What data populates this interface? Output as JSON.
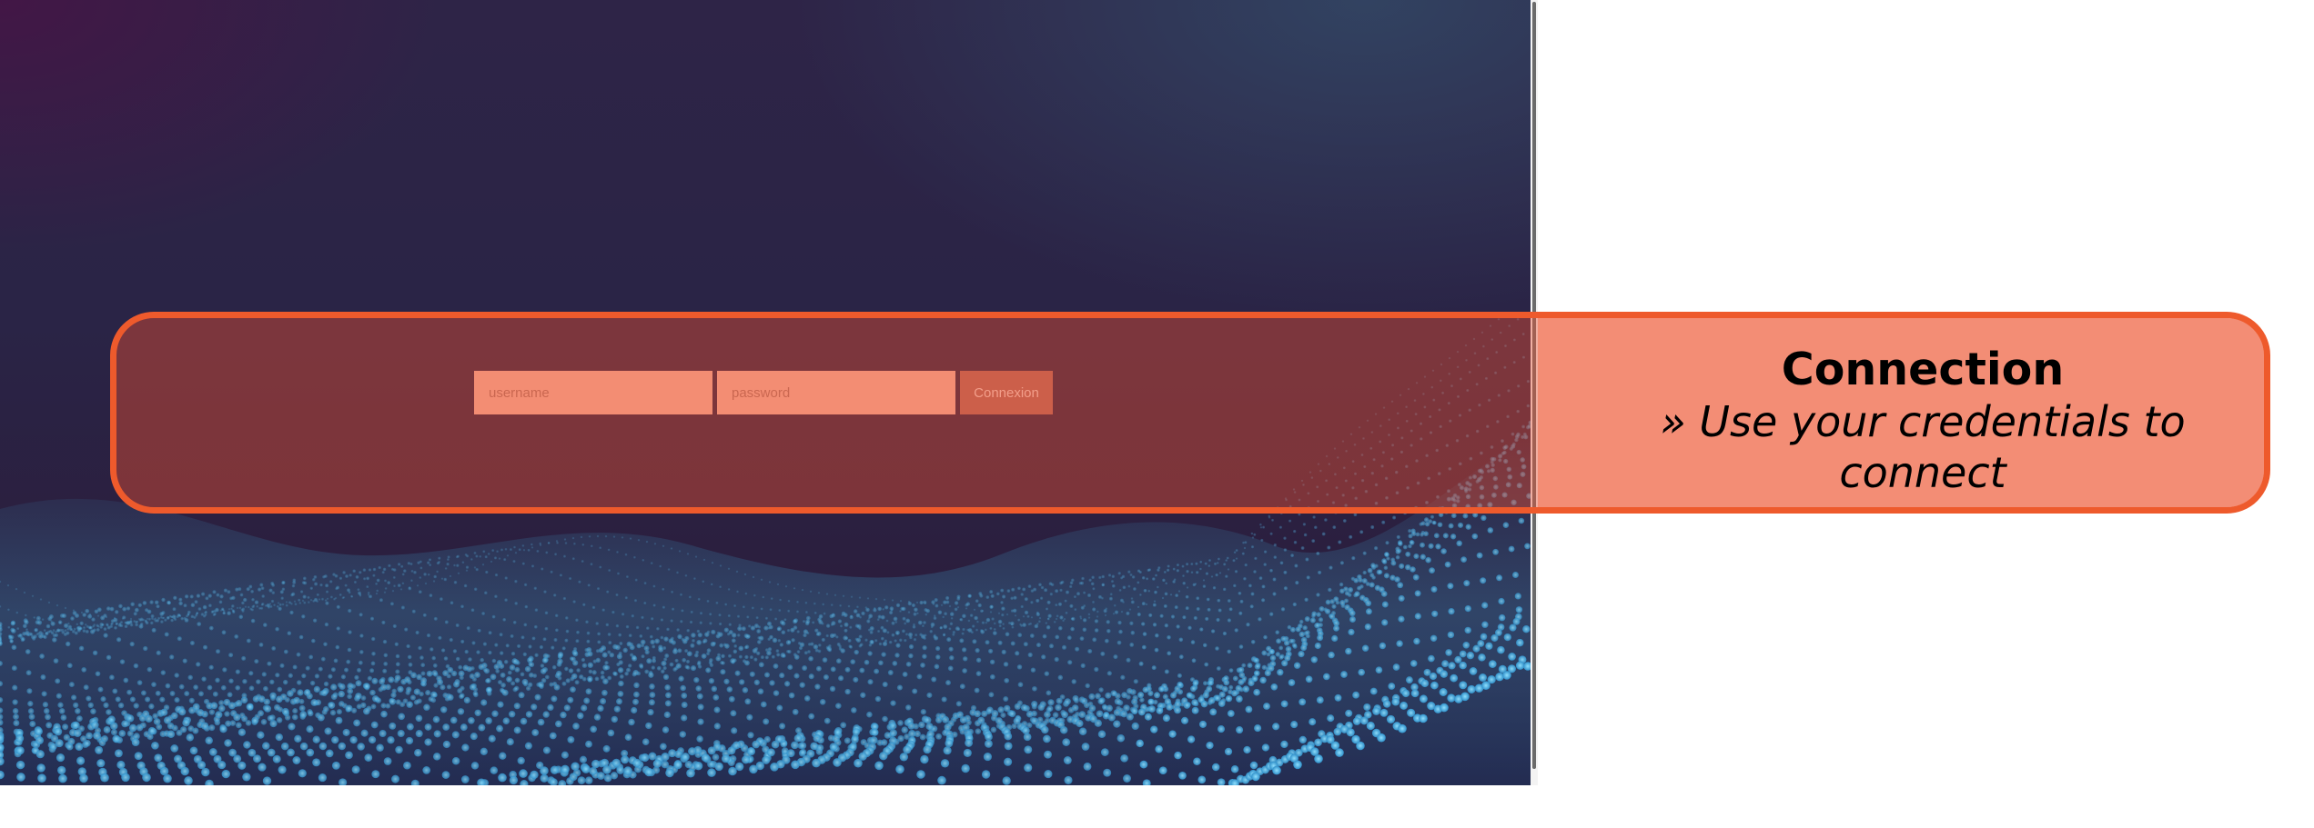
{
  "login": {
    "username_placeholder": "username",
    "password_placeholder": "password",
    "submit_label": "Connexion"
  },
  "annotation": {
    "title": "Connection",
    "description": "» Use your credentials to connect"
  },
  "colors": {
    "highlight_border": "#ee5a2c",
    "highlight_fill": "rgba(238,80,50,0.42)",
    "input_background": "#f7b8a3",
    "button_background": "#b46a5c",
    "annotation_background": "#f7b9a6"
  },
  "icons": {
    "background": "particle-wave-background"
  }
}
